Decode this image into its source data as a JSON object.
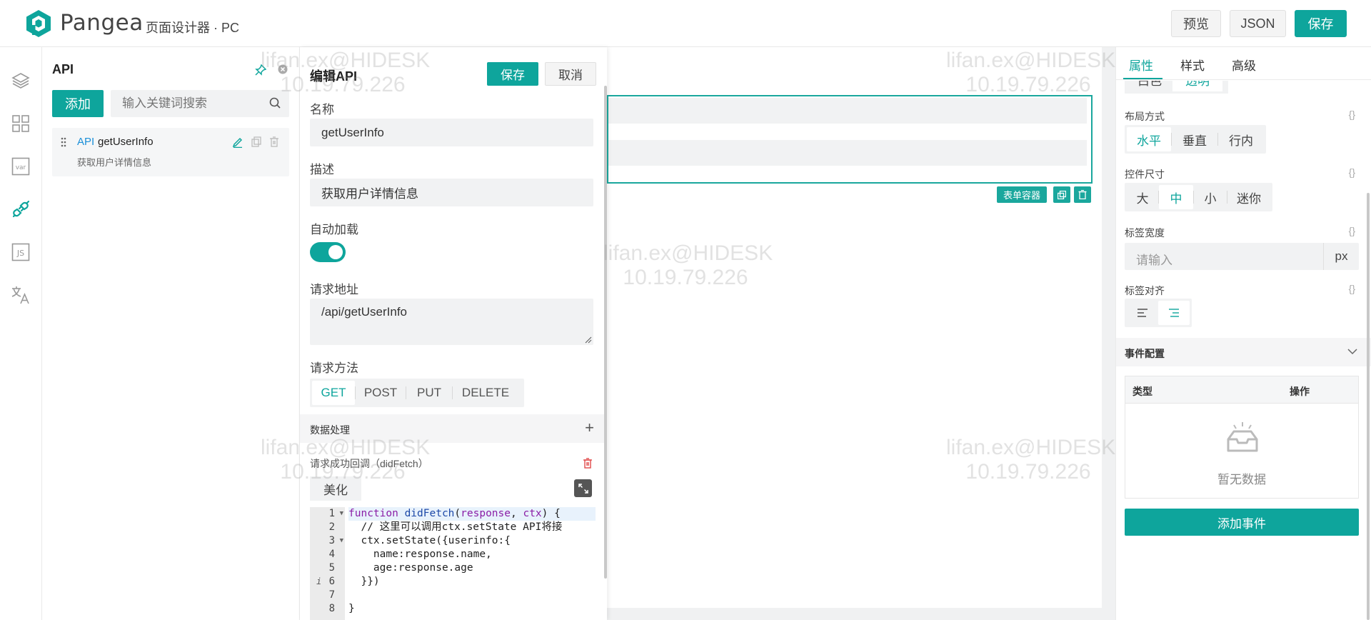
{
  "header": {
    "brand": "Pangea",
    "subtitle": "页面设计器 · PC",
    "buttons": {
      "preview": "预览",
      "json": "JSON",
      "save": "保存"
    },
    "accent": "#0ea59c"
  },
  "iconbar": {
    "icons": [
      "layers-icon",
      "components-grid-icon",
      "variables-icon",
      "api-plug-icon",
      "js-icon",
      "translate-icon"
    ],
    "var_label": "var",
    "js_label": "JS"
  },
  "api_panel": {
    "title": "API",
    "add_label": "添加",
    "search_placeholder": "输入关键词搜索",
    "items": [
      {
        "tag": "API",
        "name": "getUserInfo",
        "desc": "获取用户详情信息"
      }
    ]
  },
  "editor": {
    "title": "编辑API",
    "save_label": "保存",
    "cancel_label": "取消",
    "name_label": "名称",
    "name_value": "getUserInfo",
    "desc_label": "描述",
    "desc_value": "获取用户详情信息",
    "autoload_label": "自动加载",
    "autoload_on": true,
    "url_label": "请求地址",
    "url_value": "/api/getUserInfo",
    "method_label": "请求方法",
    "methods": [
      "GET",
      "POST",
      "PUT",
      "DELETE"
    ],
    "selected_method": "GET",
    "data_section": "数据处理",
    "callback_title": "请求成功回调（didFetch）",
    "beautify_label": "美化",
    "code_lines": [
      "function didFetch(response, ctx) {",
      "  // 这里可以调用ctx.setState API将接",
      "  ctx.setState({userinfo:{",
      "    name:response.name,",
      "    age:response.age",
      "  }})",
      "",
      "}"
    ],
    "line_numbers": [
      "1",
      "2",
      "3",
      "4",
      "5",
      "6",
      "7",
      "8"
    ]
  },
  "canvas": {
    "form_container_label": "表单容器"
  },
  "props": {
    "tabs": [
      "属性",
      "样式",
      "高级"
    ],
    "active_tab": "属性",
    "partial_options": [
      "白色",
      "透明"
    ],
    "layout_label": "布局方式",
    "layout_options": [
      "水平",
      "垂直",
      "行内"
    ],
    "layout_selected": "水平",
    "size_label": "控件尺寸",
    "size_options": [
      "大",
      "中",
      "小",
      "迷你"
    ],
    "size_selected": "中",
    "label_width_label": "标签宽度",
    "label_width_placeholder": "请输入",
    "label_width_unit": "px",
    "label_align_label": "标签对齐",
    "brace": "{}",
    "events_title": "事件配置",
    "events_columns": [
      "类型",
      "操作"
    ],
    "events_empty": "暂无数据",
    "add_event_label": "添加事件"
  },
  "watermark": {
    "user": "lifan.ex@HIDESK",
    "ip": "10.19.79.226"
  }
}
